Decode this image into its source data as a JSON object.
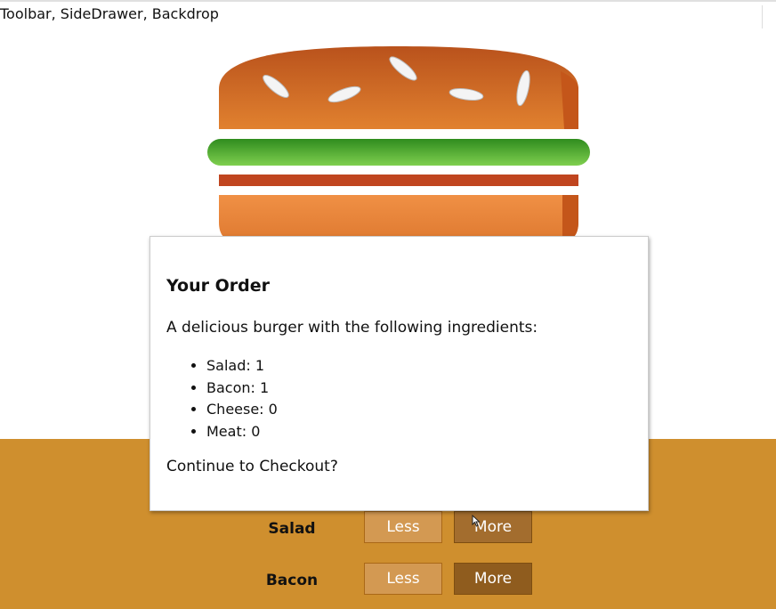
{
  "toolbar": {
    "title": "Toolbar, SideDrawer, Backdrop"
  },
  "burger": {
    "ingredients_shown": [
      "bread-top",
      "salad",
      "bacon",
      "bread-bottom"
    ],
    "colors": {
      "bread": "#e0782a",
      "bread_dark": "#c4561a",
      "salad": "#4aa82e",
      "bacon": "#c0451f",
      "controls_background": "#cf8f2e"
    }
  },
  "modal": {
    "title": "Your Order",
    "description": "A delicious burger with the following ingredients:",
    "ingredients": [
      {
        "name": "Salad",
        "amount": 1,
        "text": "Salad: 1"
      },
      {
        "name": "Bacon",
        "amount": 1,
        "text": "Bacon: 1"
      },
      {
        "name": "Cheese",
        "amount": 0,
        "text": "Cheese: 0"
      },
      {
        "name": "Meat",
        "amount": 0,
        "text": "Meat: 0"
      }
    ],
    "question": "Continue to Checkout?"
  },
  "controls": [
    {
      "label": "Salad",
      "less_label": "Less",
      "more_label": "More"
    },
    {
      "label": "Bacon",
      "less_label": "Less",
      "more_label": "More"
    }
  ]
}
